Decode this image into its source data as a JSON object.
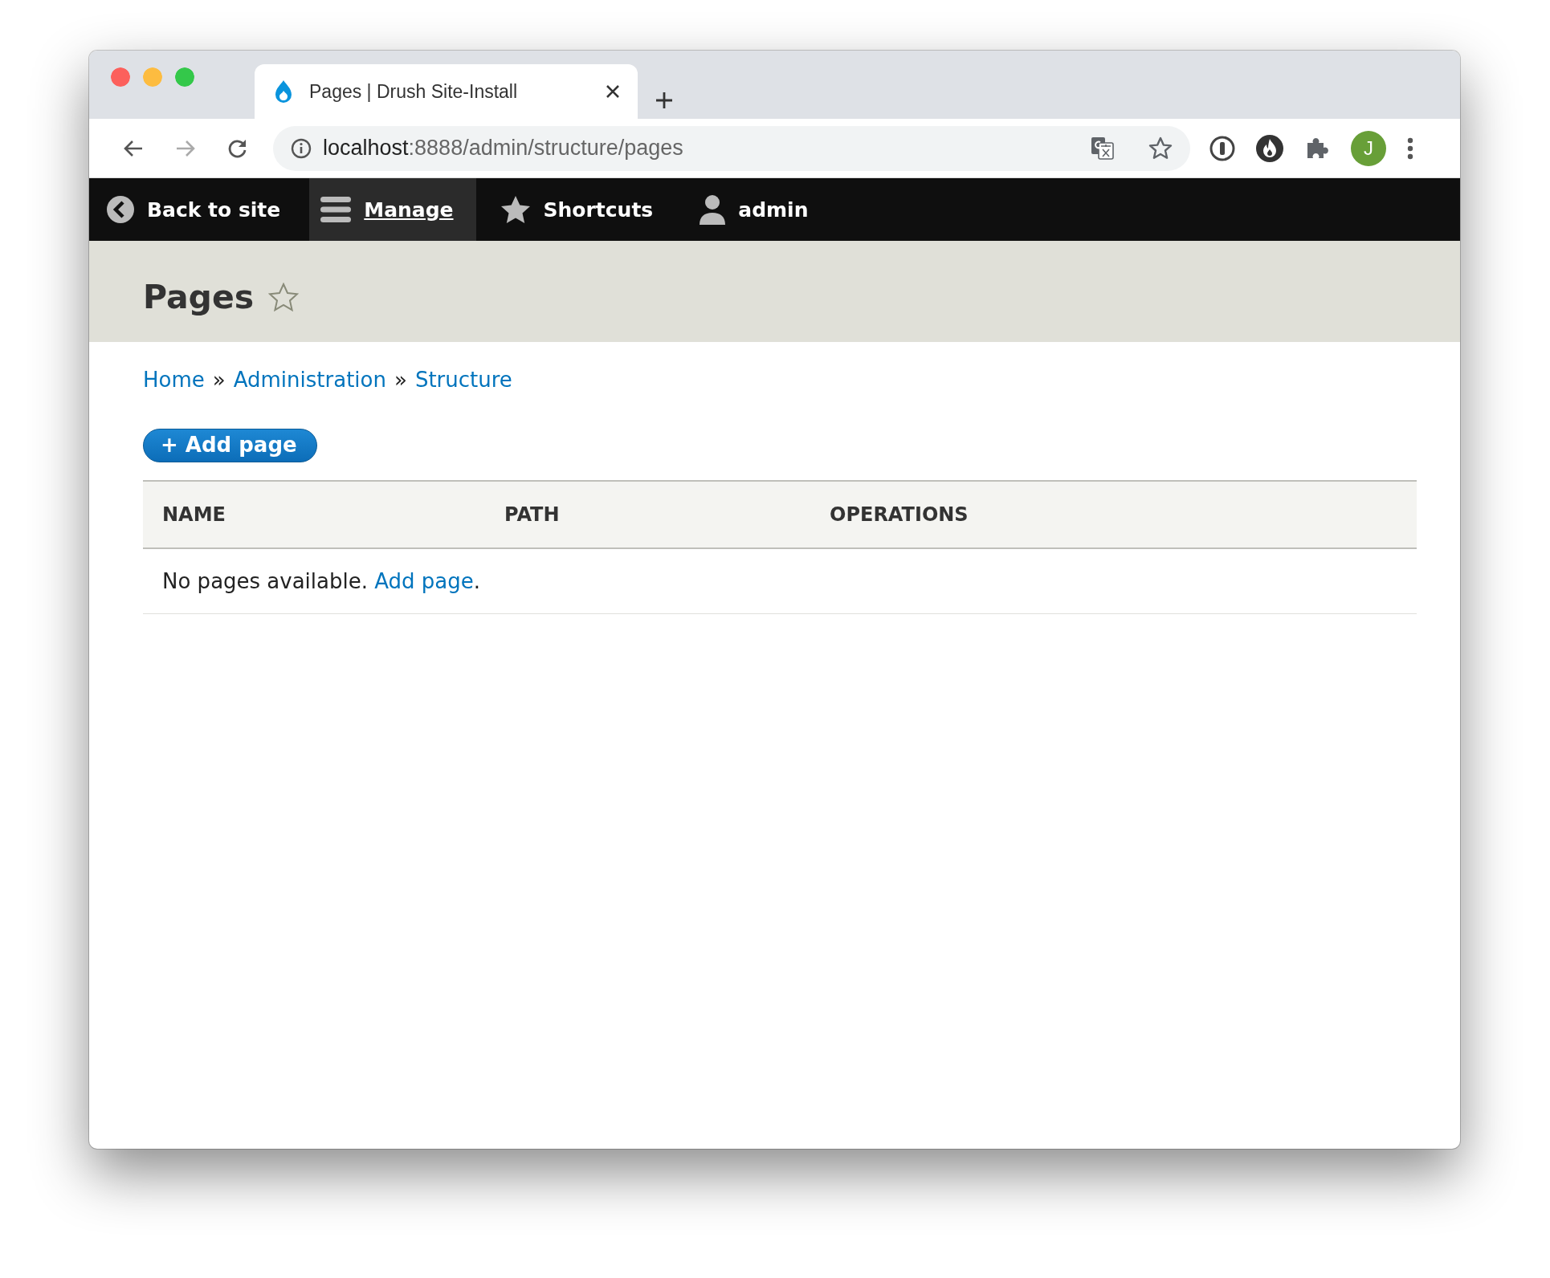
{
  "browser": {
    "tab": {
      "title": "Pages | Drush Site-Install",
      "selected": true
    },
    "address": {
      "host": "localhost",
      "path": ":8888/admin/structure/pages"
    },
    "avatar": "J"
  },
  "toolbar": {
    "items": [
      {
        "kind": "back",
        "label": "Back to site",
        "selected": false
      },
      {
        "kind": "menu",
        "label": "Manage",
        "selected": true
      },
      {
        "kind": "star",
        "label": "Shortcuts",
        "selected": false
      },
      {
        "kind": "user",
        "label": "admin",
        "selected": false
      }
    ]
  },
  "page": {
    "title": "Pages",
    "breadcrumb": [
      "Home",
      "Administration",
      "Structure"
    ],
    "separator": "»",
    "action_button": "+ Add page",
    "table": {
      "columns": [
        "NAME",
        "PATH",
        "OPERATIONS"
      ],
      "empty_message": "No pages available. ",
      "empty_link": "Add page",
      "empty_end": "."
    }
  }
}
